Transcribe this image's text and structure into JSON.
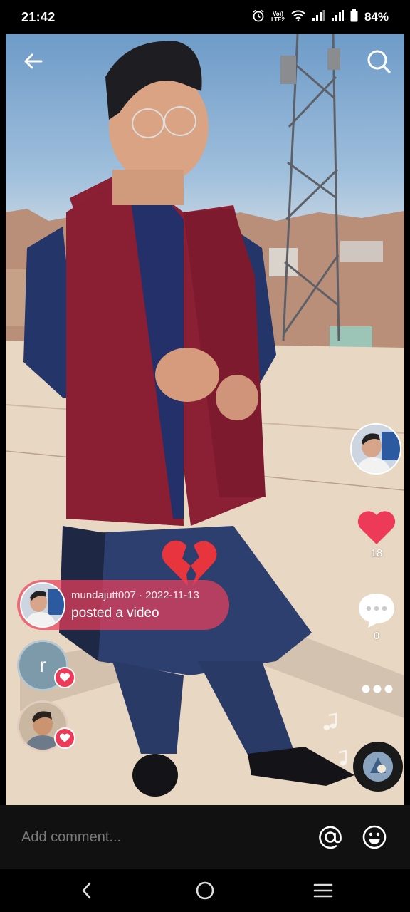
{
  "status_bar": {
    "time": "21:42",
    "network_label_top": "Vo))",
    "network_label_bottom": "LTE2",
    "battery": "84%"
  },
  "header": {
    "back_icon": "arrow-left-icon",
    "search_icon": "search-icon"
  },
  "rail": {
    "like_count": "18",
    "comment_count": "0"
  },
  "activity": {
    "meta": "mundajutt007 · 2022-11-13",
    "action": "posted a video"
  },
  "viewers": [
    {
      "initial": "r",
      "color": "#7d9aaa"
    },
    {
      "initial": "",
      "color": "#caa58a"
    }
  ],
  "comment_bar": {
    "placeholder": "Add comment..."
  },
  "colors": {
    "like_red": "#ee3a59",
    "activity_pink": "#ea405c"
  }
}
